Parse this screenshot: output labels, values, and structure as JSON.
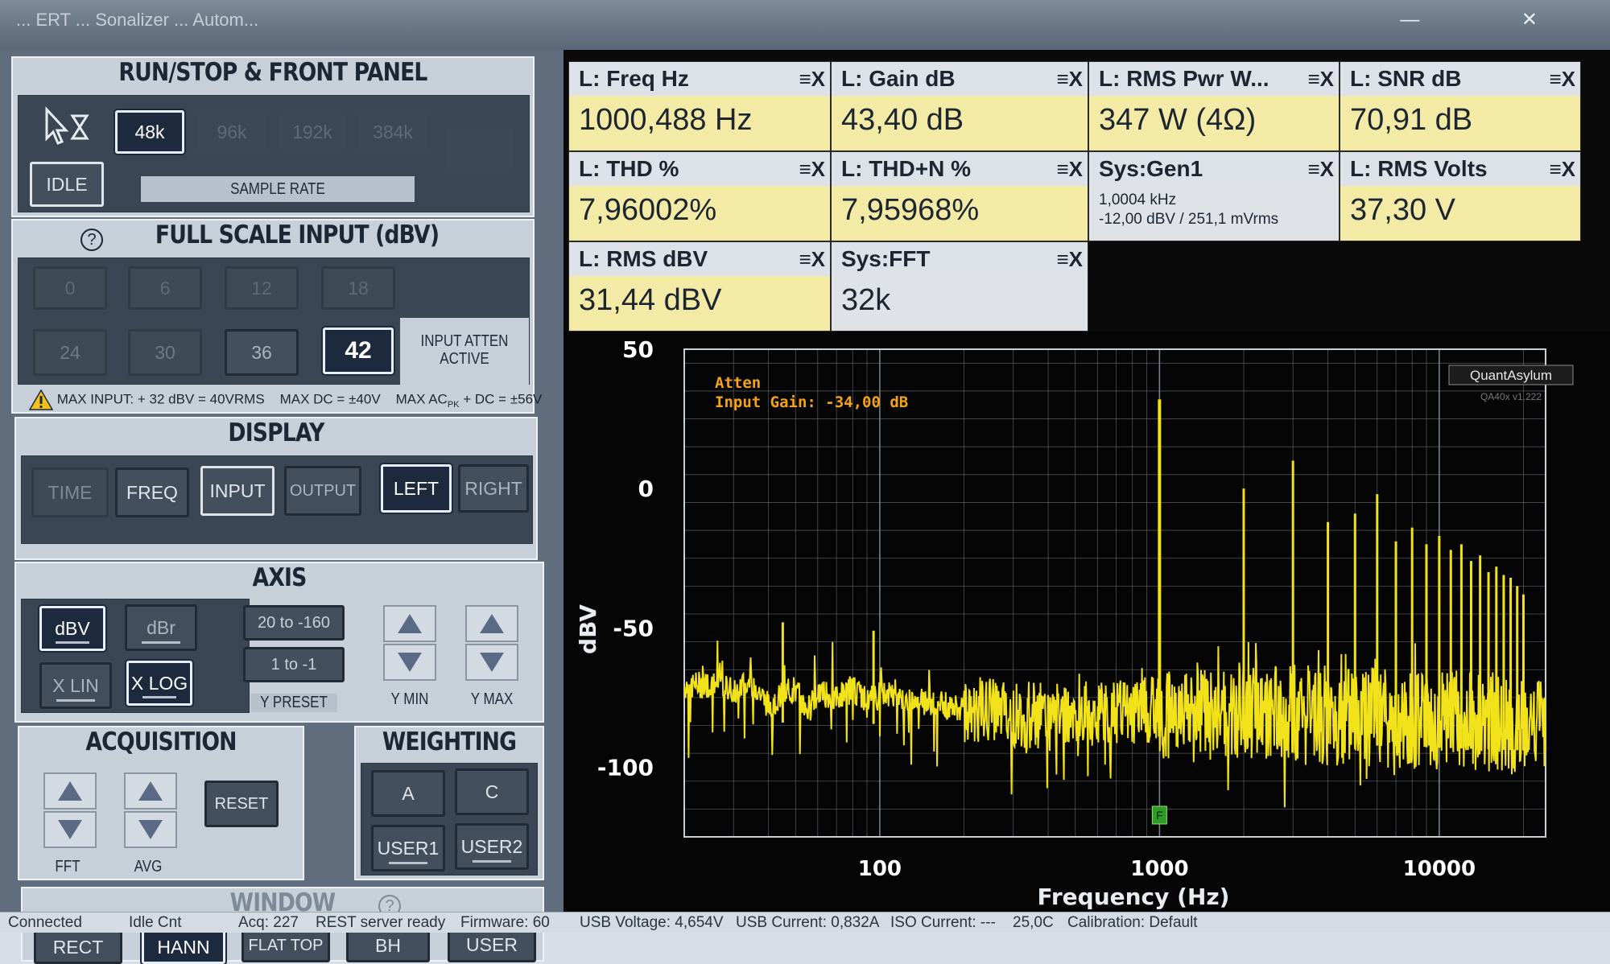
{
  "titlebar": {
    "text": "... ERT ... Sonalizer ... Autom...",
    "controls": "— ✕"
  },
  "run_stop": {
    "title": "RUN/STOP & FRONT PANEL",
    "idle_label": "IDLE",
    "sample_rates": [
      "48k",
      "96k",
      "192k",
      "384k"
    ],
    "sample_rate_label": "SAMPLE RATE"
  },
  "full_scale": {
    "title": "FULL SCALE INPUT (dBV)",
    "row1": [
      "0",
      "6",
      "12",
      "18"
    ],
    "row2": [
      "24",
      "30",
      "36",
      "42"
    ],
    "selected": "42",
    "atten_label_1": "INPUT ATTEN",
    "atten_label_2": "ACTIVE",
    "warning_1": "MAX INPUT: + 32 dBV = 40VRMS",
    "warning_2": "MAX DC = ±40V",
    "warning_3a": "MAX AC",
    "warning_3b": "PK",
    "warning_3c": " + DC = ±56V"
  },
  "display": {
    "title": "DISPLAY",
    "buttons": [
      "TIME",
      "FREQ",
      "INPUT",
      "OUTPUT",
      "LEFT",
      "RIGHT"
    ]
  },
  "axis": {
    "title": "AXIS",
    "dbv": "dBV",
    "dbr": "dBr",
    "xlin": "X LIN",
    "xlog": "X LOG",
    "preset1": "20 to -160",
    "preset2": "1 to -1",
    "y_preset": "Y PRESET",
    "y_min": "Y MIN",
    "y_max": "Y MAX"
  },
  "acquisition": {
    "title": "ACQUISITION",
    "reset": "RESET",
    "fft": "FFT",
    "avg": "AVG"
  },
  "weighting": {
    "title": "WEIGHTING",
    "buttons": [
      "A",
      "C",
      "USER1",
      "USER2"
    ]
  },
  "window": {
    "title": "WINDOW",
    "buttons": [
      "RECT",
      "HANN",
      "FLAT TOP",
      "BH",
      "USER"
    ]
  },
  "meters": [
    {
      "label": "L: Freq Hz",
      "value": "1000,488 Hz"
    },
    {
      "label": "L: Gain dB",
      "value": "43,40 dB"
    },
    {
      "label": "L: RMS Pwr W...",
      "value": "347 W (4Ω)"
    },
    {
      "label": "L: SNR dB",
      "value": "70,91 dB"
    },
    {
      "label": "L: THD %",
      "value": "7,96002%"
    },
    {
      "label": "L: THD+N %",
      "value": "7,95968%"
    },
    {
      "label": "Sys:Gen1",
      "value_line1": "1,0004 kHz",
      "value_line2": "-12,00 dBV  / 251,1 mVrms"
    },
    {
      "label": "L: RMS Volts",
      "value": "37,30 V"
    },
    {
      "label": "L: RMS dBV",
      "value": "31,44 dBV"
    },
    {
      "label": "Sys:FFT",
      "value": "32k"
    }
  ],
  "meter_controls": "≡X",
  "statusbar": {
    "items": [
      "Connected",
      "Idle Cnt",
      "Acq: 227",
      "REST server ready",
      "Firmware: 60",
      "USB Voltage: 4,654V",
      "USB Current: 0,832A",
      "ISO Current: ---",
      "25,0C",
      "Calibration: Default"
    ]
  },
  "colors": {
    "trace": "#f2e21a",
    "plot_bg": "#000000",
    "grid": "#7d8590",
    "annotation": "#f4a21a",
    "meter_value_bg": "#f3eaa6"
  },
  "chart_data": {
    "type": "line",
    "xlabel": "Frequency (Hz)",
    "ylabel": "dBV",
    "x_scale": "log",
    "xlim": [
      20,
      24000
    ],
    "ylim": [
      -125,
      50
    ],
    "x_ticks": [
      100,
      1000,
      10000
    ],
    "x_tick_labels": [
      "100",
      "1000",
      "10000"
    ],
    "y_ticks": [
      50,
      0,
      -50,
      -100
    ],
    "y_tick_labels": [
      "50",
      "0",
      "-50",
      "-100"
    ],
    "grid": true,
    "annotation_line1": "Atten",
    "annotation_line2": "Input Gain: -34,00 dB",
    "watermark_1": "QuantAsylum",
    "watermark_2": "QA40x v1.222",
    "marker": "F",
    "noise_floor": [
      [
        20,
        -71
      ],
      [
        25,
        -70
      ],
      [
        30,
        -72
      ],
      [
        35,
        -69
      ],
      [
        40,
        -78
      ],
      [
        45,
        -74
      ],
      [
        50,
        -72
      ],
      [
        55,
        -80
      ],
      [
        60,
        -73
      ],
      [
        70,
        -75
      ],
      [
        80,
        -72
      ],
      [
        90,
        -76
      ],
      [
        100,
        -73
      ],
      [
        120,
        -76
      ],
      [
        150,
        -77
      ],
      [
        200,
        -79
      ],
      [
        300,
        -81
      ],
      [
        500,
        -82
      ],
      [
        800,
        -80
      ],
      [
        1000,
        -79
      ],
      [
        2000,
        -80
      ],
      [
        3000,
        -81
      ],
      [
        5000,
        -82
      ],
      [
        10000,
        -83
      ],
      [
        20000,
        -84
      ]
    ],
    "harmonics": [
      {
        "x": 45,
        "y": -48
      },
      {
        "x": 95,
        "y": -51
      },
      {
        "x": 1000,
        "y": 32
      },
      {
        "x": 2000,
        "y": 0
      },
      {
        "x": 3000,
        "y": 10
      },
      {
        "x": 4000,
        "y": -12
      },
      {
        "x": 5000,
        "y": -9
      },
      {
        "x": 6000,
        "y": -2
      },
      {
        "x": 7000,
        "y": -19
      },
      {
        "x": 8000,
        "y": -14
      },
      {
        "x": 9000,
        "y": -20
      },
      {
        "x": 10000,
        "y": -17
      },
      {
        "x": 11000,
        "y": -22
      },
      {
        "x": 12000,
        "y": -20
      },
      {
        "x": 13000,
        "y": -26
      },
      {
        "x": 14000,
        "y": -24
      },
      {
        "x": 15000,
        "y": -30
      },
      {
        "x": 16000,
        "y": -28
      },
      {
        "x": 17000,
        "y": -31
      },
      {
        "x": 18000,
        "y": -32
      },
      {
        "x": 19000,
        "y": -35
      },
      {
        "x": 20000,
        "y": -38
      }
    ]
  }
}
